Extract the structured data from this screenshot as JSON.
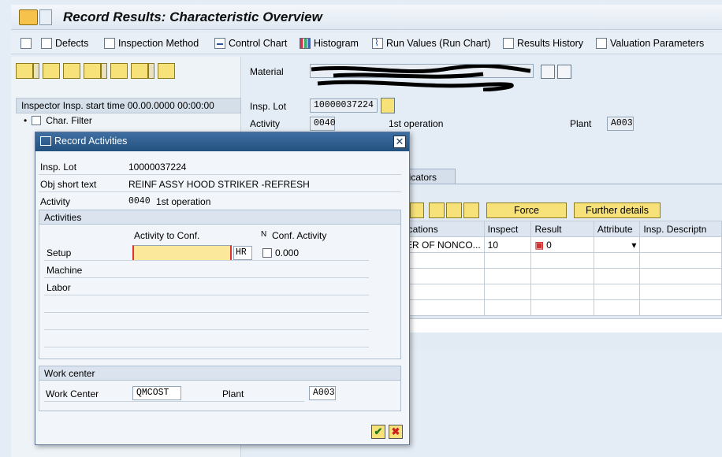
{
  "title": "Record Results: Characteristic Overview",
  "toolbar": {
    "defects": "Defects",
    "inspection_method": "Inspection Method",
    "control_chart": "Control Chart",
    "histogram": "Histogram",
    "run_values": "Run Values (Run Chart)",
    "results_history": "Results History",
    "valuation_parameters": "Valuation Parameters"
  },
  "left": {
    "inspector_header": "Inspector Insp. start time 00.00.0000 00:00:00",
    "char_filter": "Char. Filter"
  },
  "header": {
    "material_label": "Material",
    "insp_lot_label": "Insp. Lot",
    "insp_lot_value": "10000037224",
    "activity_label": "Activity",
    "activity_value": "0040",
    "activity_text": "1st operation",
    "plant_label": "Plant",
    "plant_value": "A003"
  },
  "tabs": {
    "indicators": "dicators"
  },
  "grid_toolbar": {
    "force": "Force",
    "further_details": "Further details"
  },
  "grid": {
    "columns": [
      "ications",
      "Inspect",
      "Result",
      "Attribute",
      "Insp. Descriptn"
    ],
    "rows": [
      [
        "ER OF NONCO...",
        "10",
        "0",
        "",
        ""
      ]
    ]
  },
  "dialog": {
    "title": "Record Activities",
    "insp_lot_label": "Insp. Lot",
    "insp_lot_value": "10000037224",
    "obj_short_text_label": "Obj short text",
    "obj_short_text_value": "REINF ASSY HOOD STRIKER -REFRESH",
    "activity_label": "Activity",
    "activity_code": "0040",
    "activity_text": "1st operation",
    "activities_group": "Activities",
    "col_activity_to_conf": "Activity to Conf.",
    "col_n": "N",
    "col_conf_activity": "Conf. Activity",
    "setup_label": "Setup",
    "setup_value": "",
    "setup_unit": "HR",
    "setup_conf_value": "0.000",
    "machine_label": "Machine",
    "labor_label": "Labor",
    "workcenter_group": "Work center",
    "work_center_label": "Work Center",
    "work_center_value": "QMCOST",
    "plant_label": "Plant",
    "plant_value": "A003"
  },
  "colors": {
    "title_bar": "#23517f",
    "yellow_field": "#fbe89a",
    "toolbar_yellow": "#f7e27a"
  }
}
